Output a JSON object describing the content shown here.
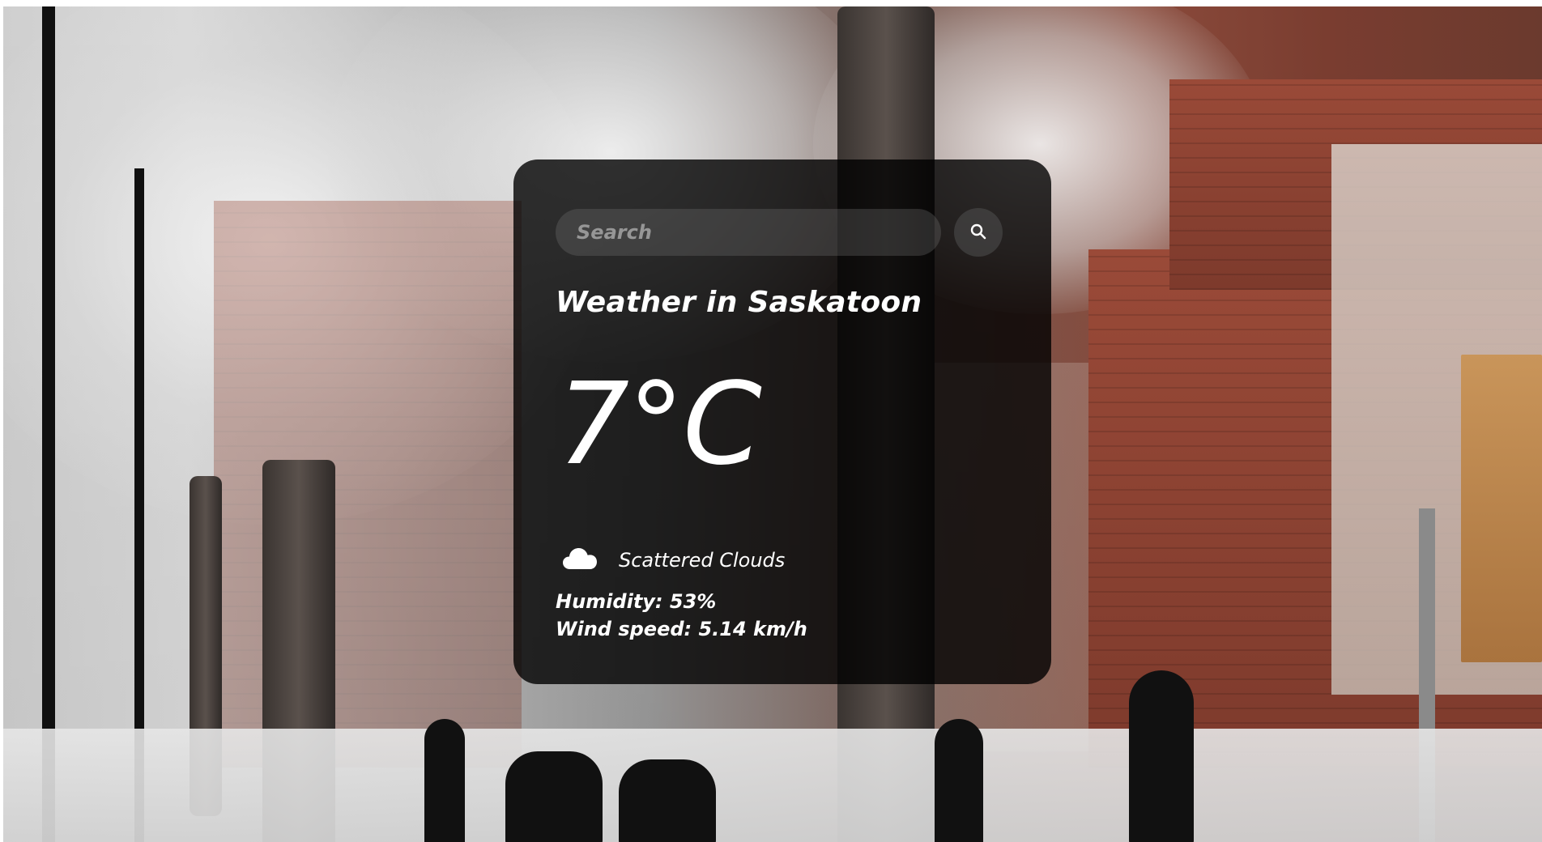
{
  "search": {
    "placeholder": "Search",
    "button_icon": "search-icon"
  },
  "weather": {
    "title": "Weather in Saskatoon",
    "temperature": "7°C",
    "condition_icon": "cloud-icon",
    "condition": "Scattered Clouds",
    "humidity": "Humidity: 53%",
    "wind": "Wind speed: 5.14 km/h"
  },
  "colors": {
    "card_background": "#000000",
    "text": "#ffffff"
  }
}
